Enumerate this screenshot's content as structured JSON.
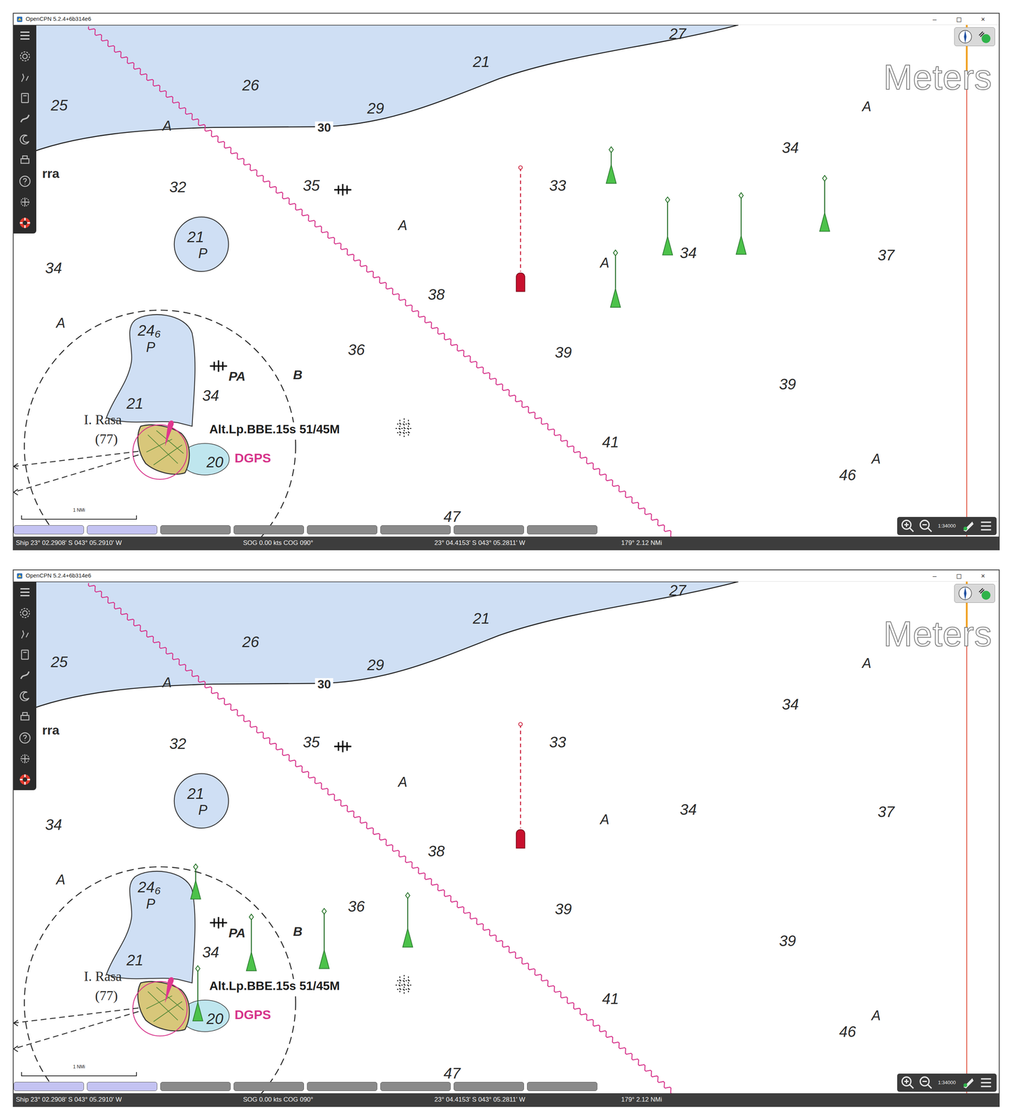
{
  "windows": [
    {
      "title": "OpenCPN 5.2.4+6b314e6",
      "controls": [
        "–",
        "◻",
        "×"
      ],
      "units": "Meters",
      "labels": [
        {
          "text": "27",
          "kind": "depth"
        },
        {
          "text": "21",
          "kind": "depth"
        },
        {
          "text": "26",
          "kind": "depth"
        },
        {
          "text": "29",
          "kind": "depth"
        },
        {
          "text": "25",
          "kind": "depth"
        },
        {
          "text": "A",
          "kind": "area"
        },
        {
          "text": "30",
          "kind": "contour"
        },
        {
          "text": "rra",
          "kind": "place"
        },
        {
          "text": "32",
          "kind": "depth"
        },
        {
          "text": "35",
          "kind": "depth"
        },
        {
          "text": "21",
          "kind": "depth"
        },
        {
          "text": "P",
          "kind": "area"
        },
        {
          "text": "34",
          "kind": "depth"
        },
        {
          "text": "A",
          "kind": "area"
        },
        {
          "text": "33",
          "kind": "depth"
        },
        {
          "text": "34",
          "kind": "depth"
        },
        {
          "text": "A",
          "kind": "area"
        },
        {
          "text": "37",
          "kind": "depth"
        },
        {
          "text": "A",
          "kind": "area"
        },
        {
          "text": "34",
          "kind": "depth"
        },
        {
          "text": "38",
          "kind": "depth"
        },
        {
          "text": "A",
          "kind": "area"
        },
        {
          "text": "36",
          "kind": "depth"
        },
        {
          "text": "39",
          "kind": "depth"
        },
        {
          "text": "39",
          "kind": "depth"
        },
        {
          "text": "24₆",
          "kind": "depth"
        },
        {
          "text": "P",
          "kind": "area"
        },
        {
          "text": "PA",
          "kind": "seabed"
        },
        {
          "text": "B",
          "kind": "seabed"
        },
        {
          "text": "34",
          "kind": "depth"
        },
        {
          "text": "21",
          "kind": "depth"
        },
        {
          "text": "I. Rasa",
          "kind": "name"
        },
        {
          "text": "(77)",
          "kind": "name"
        },
        {
          "text": "Alt.Lp.BBE.15s 51/45M",
          "kind": "light"
        },
        {
          "text": "20",
          "kind": "depth"
        },
        {
          "text": "DGPS",
          "kind": "radio"
        },
        {
          "text": "41",
          "kind": "depth"
        },
        {
          "text": "46",
          "kind": "depth"
        },
        {
          "text": "A",
          "kind": "area"
        },
        {
          "text": "47",
          "kind": "depth"
        }
      ],
      "scale_bar": "1 NMi",
      "vessels": [
        {
          "kind": "own-ship",
          "color": "#c8102e"
        },
        {
          "kind": "ais-target",
          "color": "#4cc24a"
        },
        {
          "kind": "ais-target",
          "color": "#4cc24a"
        },
        {
          "kind": "ais-target",
          "color": "#4cc24a"
        },
        {
          "kind": "ais-target",
          "color": "#4cc24a"
        },
        {
          "kind": "ais-target",
          "color": "#4cc24a"
        }
      ],
      "chart_bar": [
        {
          "selected": true
        },
        {
          "selected": true
        },
        {
          "selected": false
        },
        {
          "selected": false
        },
        {
          "selected": false
        },
        {
          "selected": false
        },
        {
          "selected": false
        },
        {
          "selected": false
        }
      ],
      "zoom": {
        "scale": "1:34000"
      },
      "status": [
        "Ship 23° 02.2908' S   043° 05.2910' W",
        "SOG 0.00 kts   COG 090°",
        "23° 04.4153' S   043° 05.2811' W",
        "179°   2.12 NMi"
      ]
    },
    {
      "title": "OpenCPN 5.2.4+6b314e6",
      "controls": [
        "–",
        "◻",
        "×"
      ],
      "units": "Meters",
      "labels": [
        {
          "text": "27",
          "kind": "depth"
        },
        {
          "text": "21",
          "kind": "depth"
        },
        {
          "text": "26",
          "kind": "depth"
        },
        {
          "text": "29",
          "kind": "depth"
        },
        {
          "text": "25",
          "kind": "depth"
        },
        {
          "text": "A",
          "kind": "area"
        },
        {
          "text": "30",
          "kind": "contour"
        },
        {
          "text": "rra",
          "kind": "place"
        },
        {
          "text": "32",
          "kind": "depth"
        },
        {
          "text": "35",
          "kind": "depth"
        },
        {
          "text": "21",
          "kind": "depth"
        },
        {
          "text": "P",
          "kind": "area"
        },
        {
          "text": "34",
          "kind": "depth"
        },
        {
          "text": "A",
          "kind": "area"
        },
        {
          "text": "33",
          "kind": "depth"
        },
        {
          "text": "34",
          "kind": "depth"
        },
        {
          "text": "A",
          "kind": "area"
        },
        {
          "text": "37",
          "kind": "depth"
        },
        {
          "text": "A",
          "kind": "area"
        },
        {
          "text": "34",
          "kind": "depth"
        },
        {
          "text": "38",
          "kind": "depth"
        },
        {
          "text": "A",
          "kind": "area"
        },
        {
          "text": "36",
          "kind": "depth"
        },
        {
          "text": "39",
          "kind": "depth"
        },
        {
          "text": "39",
          "kind": "depth"
        },
        {
          "text": "24₆",
          "kind": "depth"
        },
        {
          "text": "P",
          "kind": "area"
        },
        {
          "text": "PA",
          "kind": "seabed"
        },
        {
          "text": "B",
          "kind": "seabed"
        },
        {
          "text": "34",
          "kind": "depth"
        },
        {
          "text": "21",
          "kind": "depth"
        },
        {
          "text": "I. Rasa",
          "kind": "name"
        },
        {
          "text": "(77)",
          "kind": "name"
        },
        {
          "text": "Alt.Lp.BBE.15s 51/45M",
          "kind": "light"
        },
        {
          "text": "20",
          "kind": "depth"
        },
        {
          "text": "DGPS",
          "kind": "radio"
        },
        {
          "text": "41",
          "kind": "depth"
        },
        {
          "text": "46",
          "kind": "depth"
        },
        {
          "text": "A",
          "kind": "area"
        },
        {
          "text": "47",
          "kind": "depth"
        }
      ],
      "scale_bar": "1 NMi",
      "vessels": [
        {
          "kind": "own-ship",
          "color": "#c8102e"
        },
        {
          "kind": "ais-target",
          "color": "#4cc24a"
        },
        {
          "kind": "ais-target",
          "color": "#4cc24a"
        },
        {
          "kind": "ais-target",
          "color": "#4cc24a"
        },
        {
          "kind": "ais-target",
          "color": "#4cc24a"
        },
        {
          "kind": "ais-target",
          "color": "#4cc24a"
        }
      ],
      "chart_bar": [
        {
          "selected": true
        },
        {
          "selected": true
        },
        {
          "selected": false
        },
        {
          "selected": false
        },
        {
          "selected": false
        },
        {
          "selected": false
        },
        {
          "selected": false
        },
        {
          "selected": false
        }
      ],
      "zoom": {
        "scale": "1:34000"
      },
      "status": [
        "Ship 23° 02.2908' S   043° 05.2910' W",
        "SOG 0.00 kts   COG 090°",
        "23° 04.4153' S   043° 05.2811' W",
        "179°   2.12 NMi"
      ]
    }
  ]
}
